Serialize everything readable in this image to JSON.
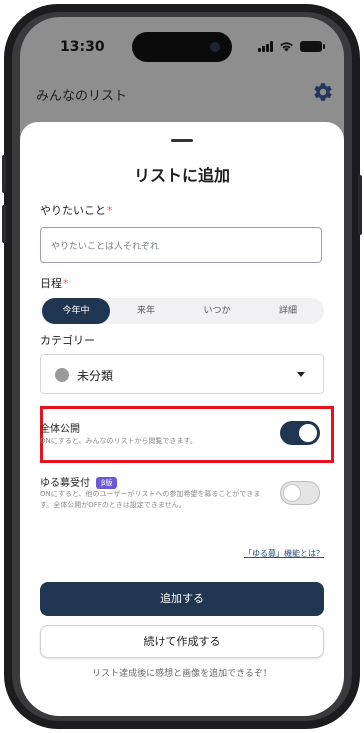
{
  "status_bar": {
    "time": "13:30"
  },
  "app_bar": {
    "title": "みんなのリスト",
    "settings_icon": "gear-icon"
  },
  "sheet": {
    "title": "リストに追加",
    "todo": {
      "label": "やりたいこと",
      "required_mark": "*",
      "placeholder": "やりたいことは人それぞれ",
      "value": ""
    },
    "schedule": {
      "label": "日程",
      "required_mark": "*",
      "options": [
        "今年中",
        "来年",
        "いつか",
        "詳細"
      ],
      "selected": "今年中"
    },
    "category": {
      "label": "カテゴリー",
      "selected": "未分類"
    },
    "public": {
      "title": "全体公開",
      "description": "ONにすると、みんなのリストから閲覧できます。",
      "enabled": true
    },
    "yurubo": {
      "title": "ゆる募受付",
      "badge": "β版",
      "description": "ONにすると、他のユーザーがリストへの参加希望を募ることができます。全体公開がOFFのときは設定できません。",
      "enabled": false
    },
    "yurubo_link": "「ゆる募」機能とは？",
    "add_button": "追加する",
    "continue_button": "続けて作成する",
    "footer_note": "リスト達成後に感想と画像を追加できるぞ！"
  },
  "colors": {
    "accent": "#203650",
    "highlight_border": "#e8121b",
    "required": "#e05a5a",
    "beta_badge": "#6a5ad8"
  }
}
